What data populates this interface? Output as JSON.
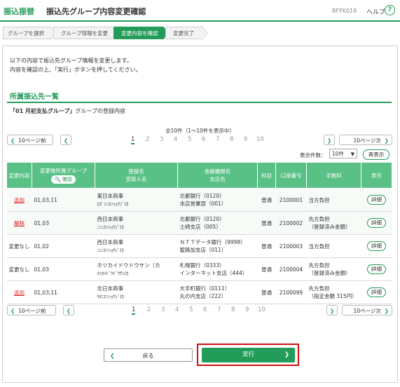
{
  "header": {
    "category": "振込振替",
    "title": "振込先グループ内容変更確認",
    "screen_code": "BFFK018",
    "help_label": "ヘルプ",
    "help_icon": "?"
  },
  "steps": [
    "グループを選択",
    "グループ情報を変更",
    "変更内容を確認",
    "変更完了"
  ],
  "active_step": 2,
  "intro": [
    "以下の内容で振込先グループ情報を変更します。",
    "内容を確認の上、「実行」ボタンを押してください。"
  ],
  "section_title": "所属振込先一覧",
  "group_caption": {
    "name": "「01 月初支払グループ」",
    "suffix": "グループの登録内容"
  },
  "pagination": {
    "total_text": "全10件（1～10件を表示中）",
    "prev_label": "10ページ前",
    "next_label": "10ページ次",
    "pages": [
      "1",
      "2",
      "3",
      "4",
      "5",
      "6",
      "7",
      "8",
      "9",
      "10"
    ],
    "current_page": "1"
  },
  "display_count": {
    "label": "表示件数：",
    "value": "10件",
    "redisplay_label": "再表示"
  },
  "table": {
    "headers": {
      "change": "変更内容",
      "group": "変更後所属グループ",
      "confirm": "確認",
      "reg_name": "登録名",
      "recipient": "受取人名",
      "bank": "金融機関名",
      "branch": "支店名",
      "type": "科目",
      "account": "口座番号",
      "fee": "手数料",
      "display": "表示"
    },
    "rows": [
      {
        "change": "追加",
        "change_link": true,
        "group": "01,03,11",
        "reg_name": "東日本商事",
        "kana": "ﾋｶﾞｼﾆﾎﾝｼｮｳｼﾞ(ｶ",
        "bank": "北都銀行（0120）",
        "branch": "本店営業部（001）",
        "type": "普通",
        "account": "2100001",
        "fee1": "当方負担",
        "fee2": "",
        "detail": "詳細"
      },
      {
        "change": "解除",
        "change_link": true,
        "group": "01,03",
        "reg_name": "西日本商事",
        "kana": "ﾆｼﾆﾎﾝｼｮｳｼﾞ(ｶ",
        "bank": "北都銀行（0120）",
        "branch": "土崎支店（005）",
        "type": "普通",
        "account": "2100002",
        "fee1": "先方負担",
        "fee2": "（登録済み金額）",
        "detail": "詳細"
      },
      {
        "change": "変更なし",
        "change_link": false,
        "group": "01,02",
        "reg_name": "西日本商事",
        "kana": "ﾆｼﾆﾎﾝｼｮｳｼﾞ(ｶ",
        "bank": "ＮＴＴデータ銀行（9998）",
        "branch": "聖路加支店（011）",
        "type": "普通",
        "account": "2100003",
        "fee1": "当方負担",
        "fee2": "",
        "detail": "詳細"
      },
      {
        "change": "変更なし",
        "change_link": false,
        "group": "01,03",
        "reg_name": "ホツカイドウドウサン（カ",
        "kana": "ﾎｯｶｲﾄﾞｳﾄﾞｳｻﾝ(ｶ",
        "bank": "札幌銀行（0333）",
        "branch": "インターネット支店（444）",
        "type": "普通",
        "account": "2100004",
        "fee1": "先方負担",
        "fee2": "（登録済み金額）",
        "detail": "詳細"
      },
      {
        "change": "追加",
        "change_link": true,
        "group": "01,03,11",
        "reg_name": "北日本商事",
        "kana": "ｷﾀﾆﾎﾝｼｮｳｼﾞ(ｶ",
        "bank": "大手町銀行（0111）",
        "branch": "丸の内支店（222）",
        "type": "普通",
        "account": "2100099",
        "fee1": "先方負担",
        "fee2": "（指定金額 315円）",
        "detail": "詳細"
      }
    ]
  },
  "buttons": {
    "back": "戻る",
    "execute": "実行"
  },
  "colors": {
    "brand_green": "#239c5a",
    "header_green": "#5ac186",
    "highlight_red": "#d01010",
    "link_red": "#e02020"
  }
}
